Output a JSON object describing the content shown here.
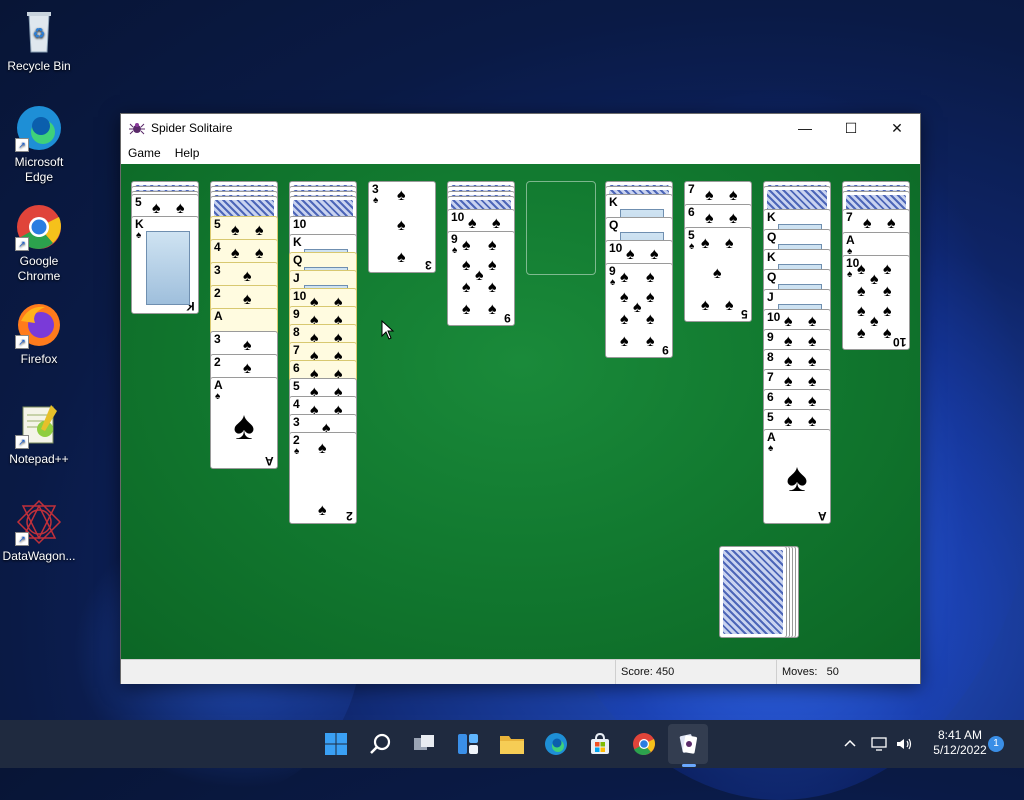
{
  "desktop": {
    "icons": [
      {
        "label": "Recycle Bin",
        "icon": "recycle-bin-icon"
      },
      {
        "label": "Microsoft Edge",
        "icon": "edge-icon"
      },
      {
        "label": "Google Chrome",
        "icon": "chrome-icon"
      },
      {
        "label": "Firefox",
        "icon": "firefox-icon"
      },
      {
        "label": "Notepad++",
        "icon": "notepad-plus-plus-icon"
      },
      {
        "label": "DataWagon...",
        "icon": "datawagon-icon"
      }
    ]
  },
  "window": {
    "title": "Spider Solitaire",
    "minimize_glyph": "—",
    "maximize_glyph": "☐",
    "close_glyph": "✕",
    "menu": [
      {
        "label": "Game"
      },
      {
        "label": "Help"
      }
    ]
  },
  "game": {
    "suit": "♠",
    "columns": [
      {
        "id": 1,
        "face_up": [
          "5",
          "K"
        ]
      },
      {
        "id": 2,
        "face_up": [
          "5",
          "4",
          "3",
          "2",
          "A",
          "3",
          "2",
          "A"
        ]
      },
      {
        "id": 3,
        "face_up": [
          "10",
          "K",
          "Q",
          "J",
          "10",
          "9",
          "8",
          "7",
          "6",
          "5",
          "4",
          "3",
          "2"
        ]
      },
      {
        "id": 4,
        "face_up": [
          "3"
        ]
      },
      {
        "id": 5,
        "face_up": [
          "10",
          "9"
        ]
      },
      {
        "id": 6,
        "face_up": []
      },
      {
        "id": 7,
        "face_up": [
          "K",
          "Q",
          "10",
          "9"
        ]
      },
      {
        "id": 8,
        "face_up": [
          "7",
          "6",
          "5"
        ]
      },
      {
        "id": 9,
        "face_up": [
          "K",
          "Q",
          "K",
          "Q",
          "J",
          "10",
          "9",
          "8",
          "7",
          "6",
          "5",
          "A"
        ]
      },
      {
        "id": 10,
        "face_up": [
          "7",
          "A",
          "10"
        ]
      }
    ],
    "stock_piles": 5
  },
  "status": {
    "score_label": "Score: 450",
    "moves_label": "Moves:",
    "moves_value": "50"
  },
  "taskbar": {
    "apps": [
      "start-icon",
      "search-icon",
      "task-view-icon",
      "widgets-icon",
      "file-explorer-icon",
      "edge-icon",
      "store-icon",
      "chrome-icon",
      "spider-solitaire-icon"
    ],
    "time": "8:41 AM",
    "date": "5/12/2022",
    "notification_count": "1"
  }
}
